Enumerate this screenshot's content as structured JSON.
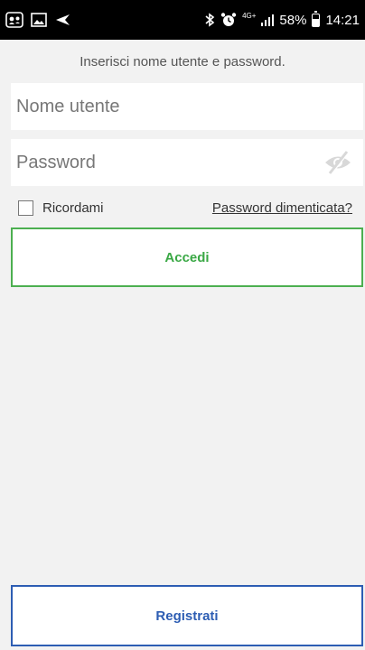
{
  "status_bar": {
    "network_label": "4G+",
    "battery_percent": "58%",
    "battery_level": 0.58,
    "time": "14:21",
    "icons_left": [
      "notification-app-icon",
      "image-icon",
      "navigation-arrow-icon"
    ],
    "icons_right": [
      "bluetooth-icon",
      "alarm-icon",
      "signal-icon",
      "battery-icon"
    ]
  },
  "login": {
    "subtitle": "Inserisci nome utente e password.",
    "username": {
      "value": "",
      "placeholder": "Nome utente"
    },
    "password": {
      "value": "",
      "placeholder": "Password"
    },
    "remember_label": "Ricordami",
    "forgot_label": "Password dimenticata?",
    "login_button": "Accedi",
    "register_button": "Registrati"
  },
  "colors": {
    "background": "#f2f2f2",
    "login_accent": "#4caf50",
    "register_accent": "#2d5db3"
  }
}
